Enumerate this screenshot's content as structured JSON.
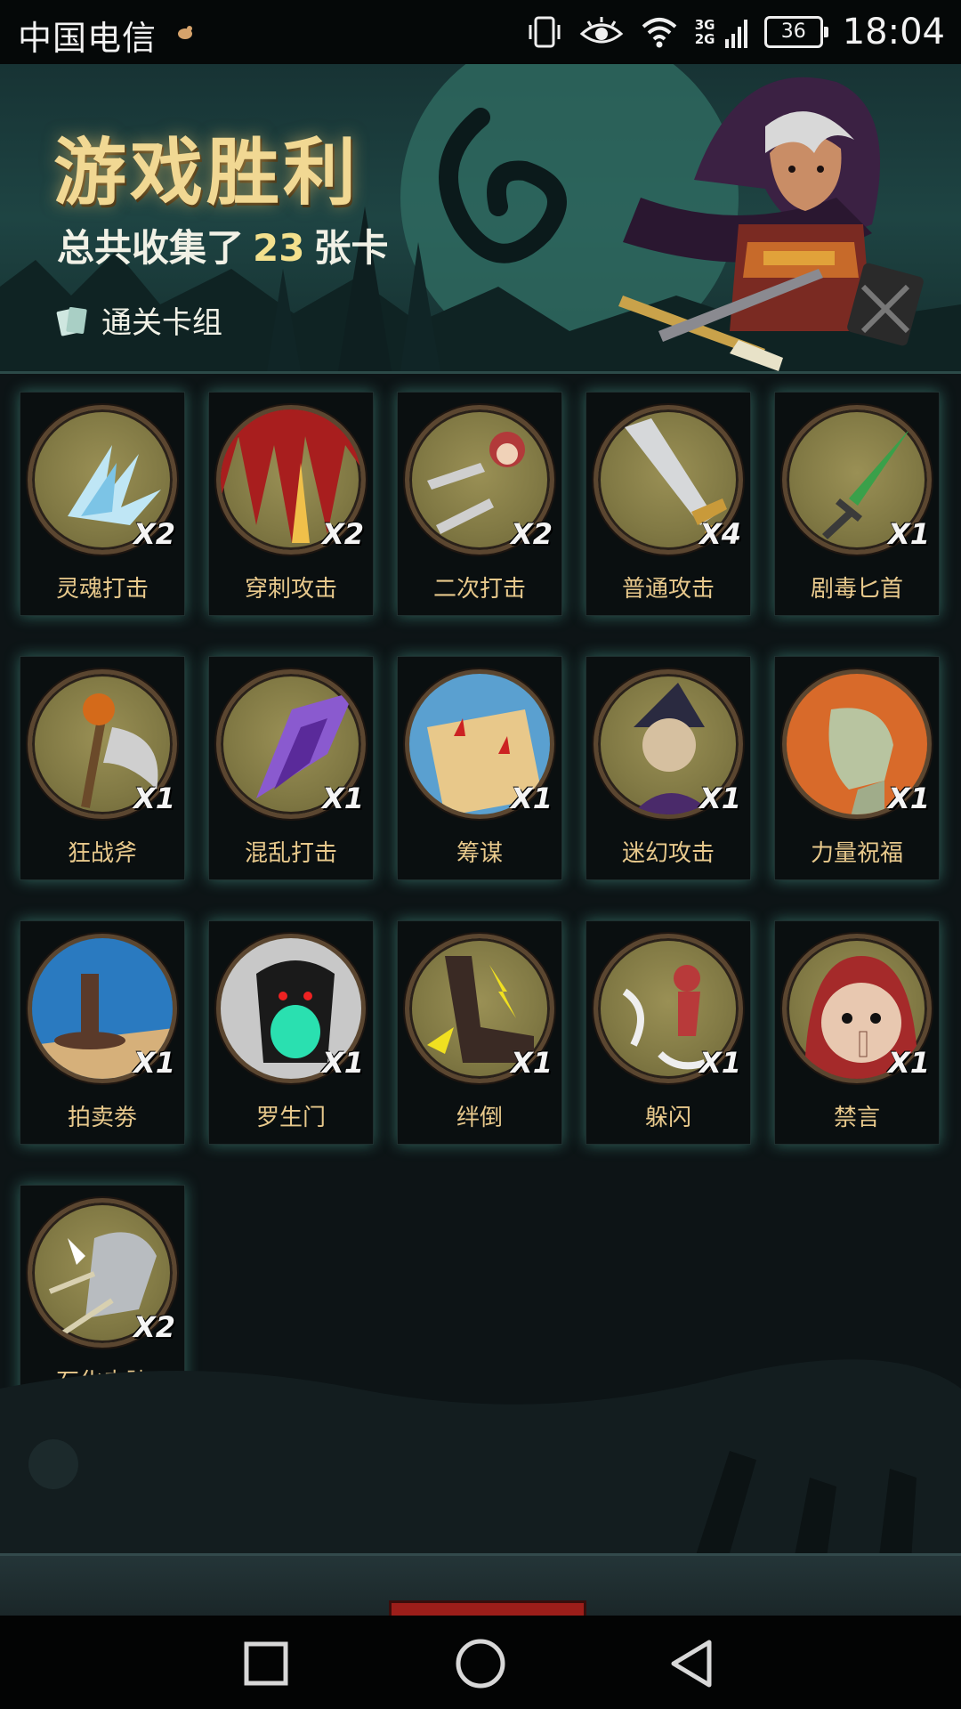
{
  "status_bar": {
    "carrier": "中国电信",
    "network_label": "3G 2G",
    "battery": "36",
    "time": "18:04"
  },
  "banner": {
    "title": "游戏胜利",
    "summary_prefix": "总共收集了",
    "card_count": "23",
    "summary_suffix": "张卡",
    "deck_link": "通关卡组"
  },
  "cards": [
    {
      "name": "灵魂打击",
      "qty": "X2",
      "icon": "ice-shards-icon"
    },
    {
      "name": "穿刺攻击",
      "qty": "X2",
      "icon": "spikes-icon"
    },
    {
      "name": "二次打击",
      "qty": "X2",
      "icon": "daggers-icon"
    },
    {
      "name": "普通攻击",
      "qty": "X4",
      "icon": "sword-icon"
    },
    {
      "name": "剧毒匕首",
      "qty": "X1",
      "icon": "poison-dagger-icon"
    },
    {
      "name": "狂战斧",
      "qty": "X1",
      "icon": "axe-icon"
    },
    {
      "name": "混乱打击",
      "qty": "X1",
      "icon": "chaos-strike-icon"
    },
    {
      "name": "筹谋",
      "qty": "X1",
      "icon": "map-icon"
    },
    {
      "name": "迷幻攻击",
      "qty": "X1",
      "icon": "witch-icon"
    },
    {
      "name": "力量祝福",
      "qty": "X1",
      "icon": "fist-icon"
    },
    {
      "name": "拍卖劵",
      "qty": "X1",
      "icon": "gavel-icon"
    },
    {
      "name": "罗生门",
      "qty": "X1",
      "icon": "demon-gate-icon"
    },
    {
      "name": "绊倒",
      "qty": "X1",
      "icon": "trip-boot-icon"
    },
    {
      "name": "躲闪",
      "qty": "X1",
      "icon": "dodge-icon"
    },
    {
      "name": "禁言",
      "qty": "X1",
      "icon": "silence-icon"
    },
    {
      "name": "石化皮肤",
      "qty": "X2",
      "icon": "stone-skin-icon"
    }
  ],
  "colors": {
    "card_name": "#e8c98c",
    "title_gold": "#f1d893",
    "count_yellow": "#f3e08d",
    "card_glow": "#5ac8b4",
    "button_red": "#9c1e1a"
  }
}
